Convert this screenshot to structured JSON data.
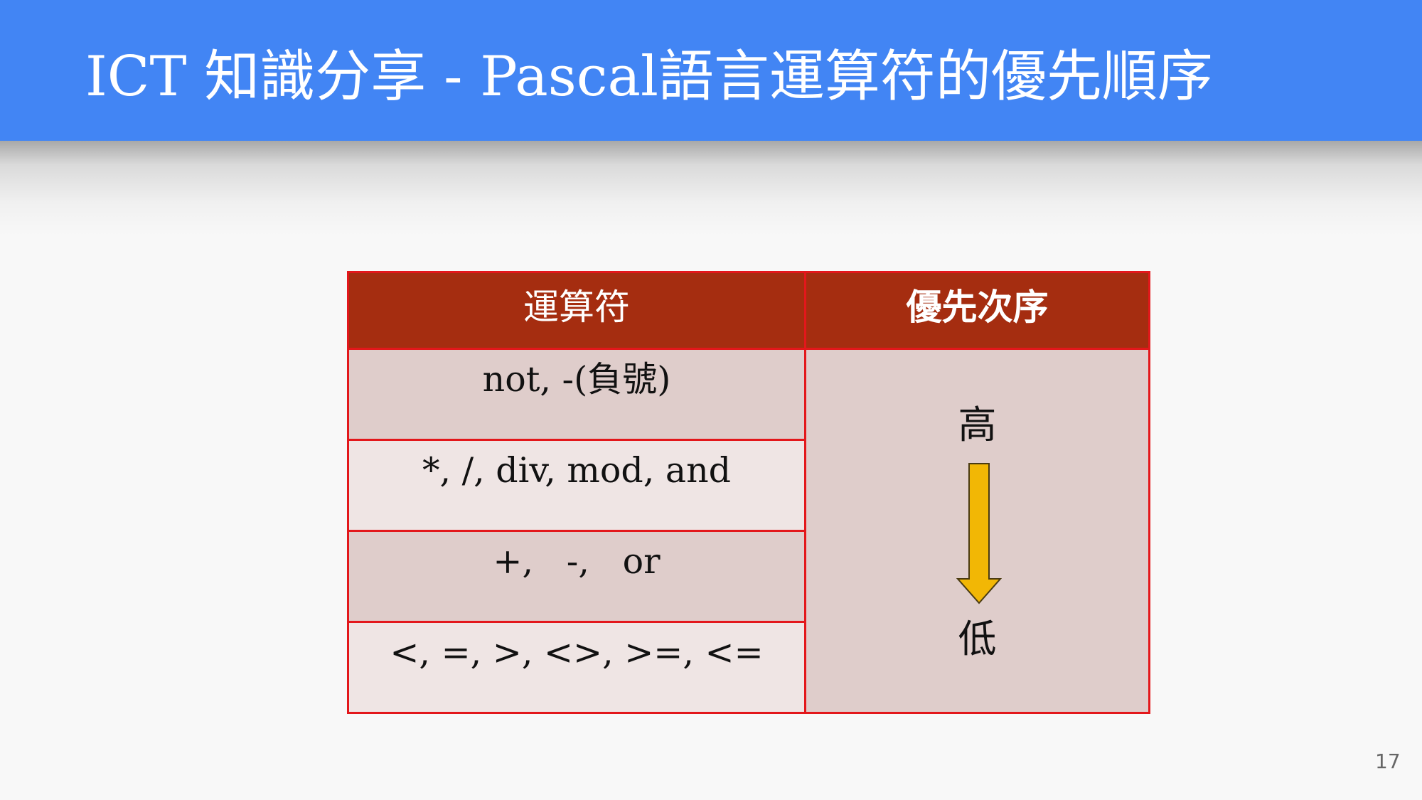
{
  "slide": {
    "title": "ICT 知識分享 - Pascal語言運算符的優先順序",
    "page_number": "17"
  },
  "table": {
    "headers": [
      "運算符",
      "優先次序"
    ],
    "operators": [
      "not, -(負號)",
      "*, /, div, mod, and",
      "+,   -,   or",
      "<, =, >, <>, >=, <="
    ],
    "priority_high": "高",
    "priority_low": "低"
  },
  "colors": {
    "header_bar": "#4285f4",
    "table_header": "#a52d10",
    "table_border": "#e3171b",
    "row_dark": "#dfcdcb",
    "row_light": "#efe5e4",
    "arrow_fill": "#f2b705"
  },
  "icons": {
    "priority_arrow": "arrow-down-icon"
  }
}
